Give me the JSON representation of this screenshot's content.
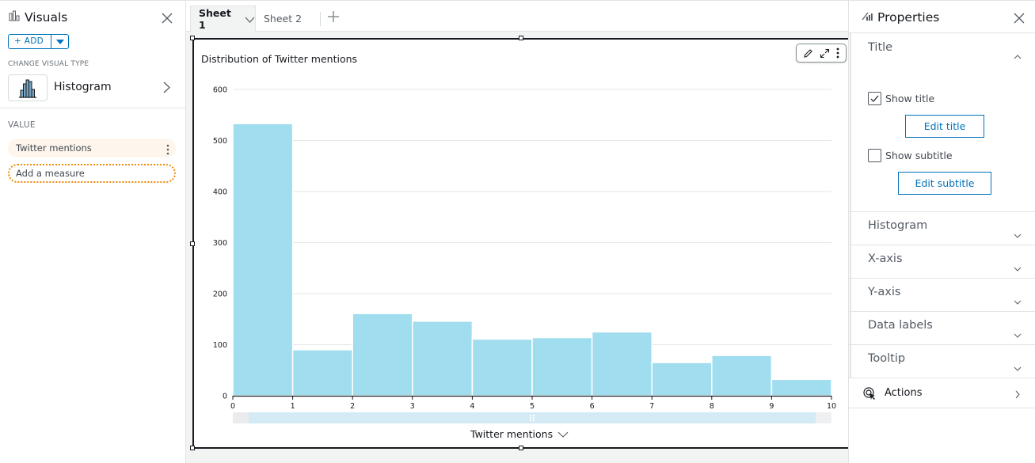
{
  "left_panel": {
    "title": "Visuals",
    "add_label": "+ ADD",
    "change_visual_type_label": "CHANGE VISUAL TYPE",
    "visual_type": "Histogram",
    "value_label": "VALUE",
    "value_field": "Twitter mentions",
    "add_measure_placeholder": "Add a measure"
  },
  "sheets": {
    "tabs": [
      {
        "label": "Sheet 1",
        "active": true
      },
      {
        "label": "Sheet 2",
        "active": false
      }
    ],
    "add_icon": "plus-icon"
  },
  "visual": {
    "toolbar_icons": [
      "pencil-icon",
      "expand-icon",
      "more-vertical-icon"
    ],
    "x_axis_field": "Twitter mentions"
  },
  "chart_data": {
    "type": "bar",
    "subtype": "histogram",
    "title": "Distribution of Twitter mentions",
    "xlabel": "Twitter mentions",
    "ylabel": "",
    "bin_edges": [
      0,
      1,
      2,
      3,
      4,
      5,
      6,
      7,
      8,
      9,
      10
    ],
    "values": [
      533,
      90,
      161,
      146,
      111,
      114,
      125,
      65,
      79,
      32
    ],
    "x_ticks": [
      "0",
      "1",
      "2",
      "3",
      "4",
      "5",
      "6",
      "7",
      "8",
      "9",
      "10"
    ],
    "y_ticks": [
      "0",
      "100",
      "200",
      "300",
      "400",
      "500",
      "600"
    ],
    "xlim": [
      0,
      10
    ],
    "ylim": [
      0,
      600
    ],
    "grid": true,
    "bar_color": "#a0ddef"
  },
  "right_panel": {
    "title": "Properties",
    "title_section": {
      "label": "Title",
      "show_title_label": "Show title",
      "show_title_checked": true,
      "edit_title_label": "Edit title",
      "show_subtitle_label": "Show subtitle",
      "show_subtitle_checked": false,
      "edit_subtitle_label": "Edit subtitle"
    },
    "sections": [
      {
        "label": "Histogram"
      },
      {
        "label": "X-axis"
      },
      {
        "label": "Y-axis"
      },
      {
        "label": "Data labels"
      },
      {
        "label": "Tooltip"
      }
    ],
    "actions_label": "Actions"
  },
  "colors": {
    "accent": "#0073bb",
    "bar": "#a0ddef",
    "pill_bg": "#fef6ec",
    "dotted_border": "#ec8c09"
  }
}
